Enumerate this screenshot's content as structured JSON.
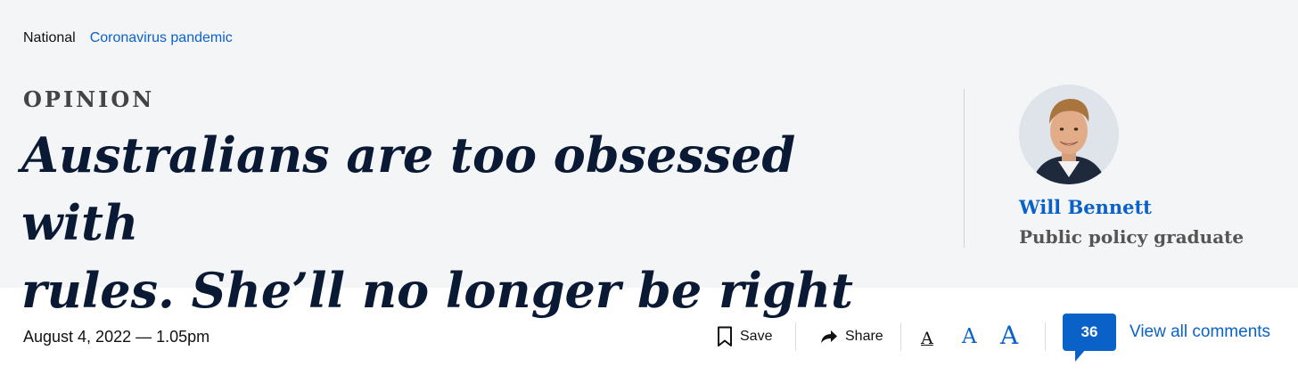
{
  "breadcrumb": {
    "section": "National",
    "topic": "Coronavirus pandemic"
  },
  "article": {
    "kicker": "OPINION",
    "headline_line1": "Australians are too obsessed with",
    "headline_line2": "rules. She’ll no longer be right"
  },
  "author": {
    "name": "Will Bennett",
    "role": "Public policy graduate"
  },
  "toolbar": {
    "date": "August 4, 2022 — 1.05pm",
    "save_label": "Save",
    "share_label": "Share",
    "font_size_glyph": "A",
    "comment_count": "36",
    "view_comments_label": "View all comments"
  },
  "colors": {
    "accent": "#0a62c8",
    "headline": "#0b1a34",
    "header_bg": "#f4f5f7"
  }
}
